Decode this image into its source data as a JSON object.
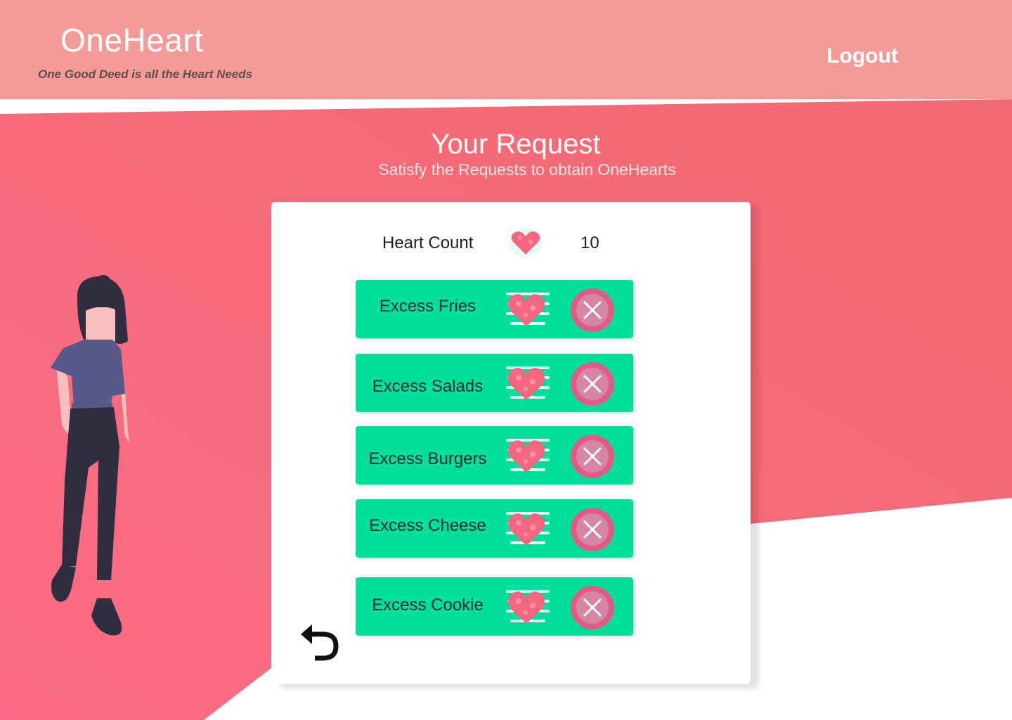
{
  "header": {
    "brand": "OneHeart",
    "tagline": "One Good Deed is all the Heart Needs",
    "logout_label": "Logout"
  },
  "main": {
    "title": "Your Request",
    "subtitle": "Satisfy the Requests to obtain OneHearts"
  },
  "heart_count": {
    "label": "Heart Count",
    "value": "10",
    "icon": "heart-icon"
  },
  "requests": [
    {
      "label": "Excess Fries"
    },
    {
      "label": "Excess Salads"
    },
    {
      "label": "Excess Burgers"
    },
    {
      "label": "Excess Cheese"
    },
    {
      "label": "Excess Cookie"
    }
  ],
  "icons": {
    "accept": "heart-icon",
    "reject": "close-icon",
    "back": "undo-arrow-icon"
  },
  "colors": {
    "header_bg": "#f49b98",
    "hero_bg": "#f76b7b",
    "request_bg": "#00e09b",
    "reject_circle": "#e05c85"
  }
}
